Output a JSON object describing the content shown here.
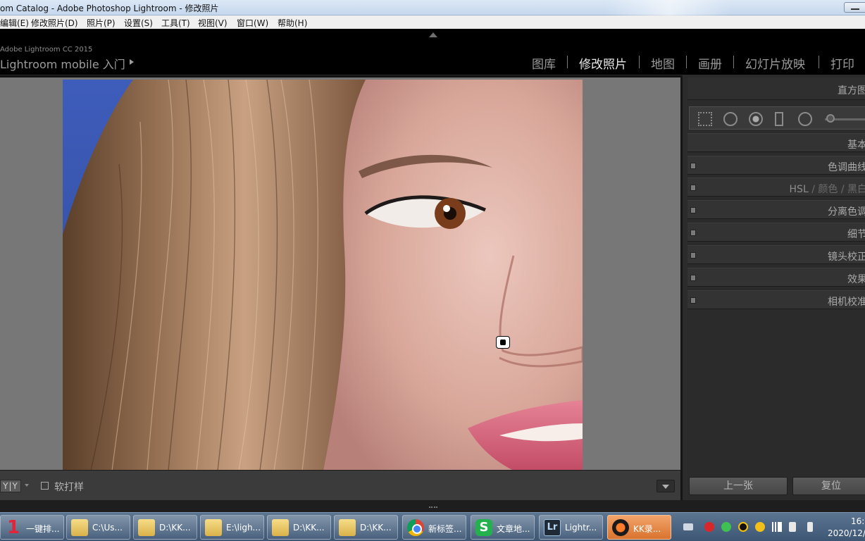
{
  "window": {
    "title": "om Catalog - Adobe Photoshop Lightroom - 修改照片"
  },
  "menu": {
    "items": [
      "编辑(E)",
      "修改照片(D)",
      "照片(P)",
      "设置(S)",
      "工具(T)",
      "视图(V)",
      "窗口(W)",
      "帮助(H)"
    ]
  },
  "identity": {
    "brand": "Adobe Lightroom CC 2015",
    "mobile": "Lightroom mobile 入门"
  },
  "modules": {
    "items": [
      "图库",
      "修改照片",
      "地图",
      "画册",
      "幻灯片放映",
      "打印"
    ],
    "active": "修改照片"
  },
  "toolbar": {
    "view_mode": "Y|Y",
    "soft_proof_label": "软打样",
    "soft_proof_checked": false
  },
  "right_panel": {
    "histogram": "直方图",
    "basic": "基本",
    "tone_curve": "色调曲线",
    "hsl": "HSL",
    "color": "颜色",
    "bw": "黑白",
    "split_toning": "分离色调",
    "detail": "细节",
    "lens_corrections": "镜头校正",
    "effects": "效果",
    "camera_calibration": "相机校准",
    "prev_button": "上一张",
    "reset_button": "复位"
  },
  "taskbar": {
    "tasks": [
      {
        "label": "一键排...",
        "icon": "red-1-icon"
      },
      {
        "label": "C:\\Us...",
        "icon": "folder-icon"
      },
      {
        "label": "D:\\KK...",
        "icon": "folder-icon"
      },
      {
        "label": "E:\\ligh...",
        "icon": "folder-icon"
      },
      {
        "label": "D:\\KK...",
        "icon": "folder-icon"
      },
      {
        "label": "D:\\KK...",
        "icon": "folder-icon"
      },
      {
        "label": "新标签...",
        "icon": "chrome-icon"
      },
      {
        "label": "文章地...",
        "icon": "wps-icon"
      },
      {
        "label": "Lightr...",
        "icon": "lightroom-icon"
      },
      {
        "label": "KK录...",
        "icon": "kk-recorder-icon",
        "active": true
      }
    ],
    "clock_time": "16:",
    "clock_date": "2020/12/"
  },
  "colors": {
    "accent_active_task": "#e07a35",
    "panel_bg": "#2b2b2b",
    "workarea_bg": "#777777"
  }
}
